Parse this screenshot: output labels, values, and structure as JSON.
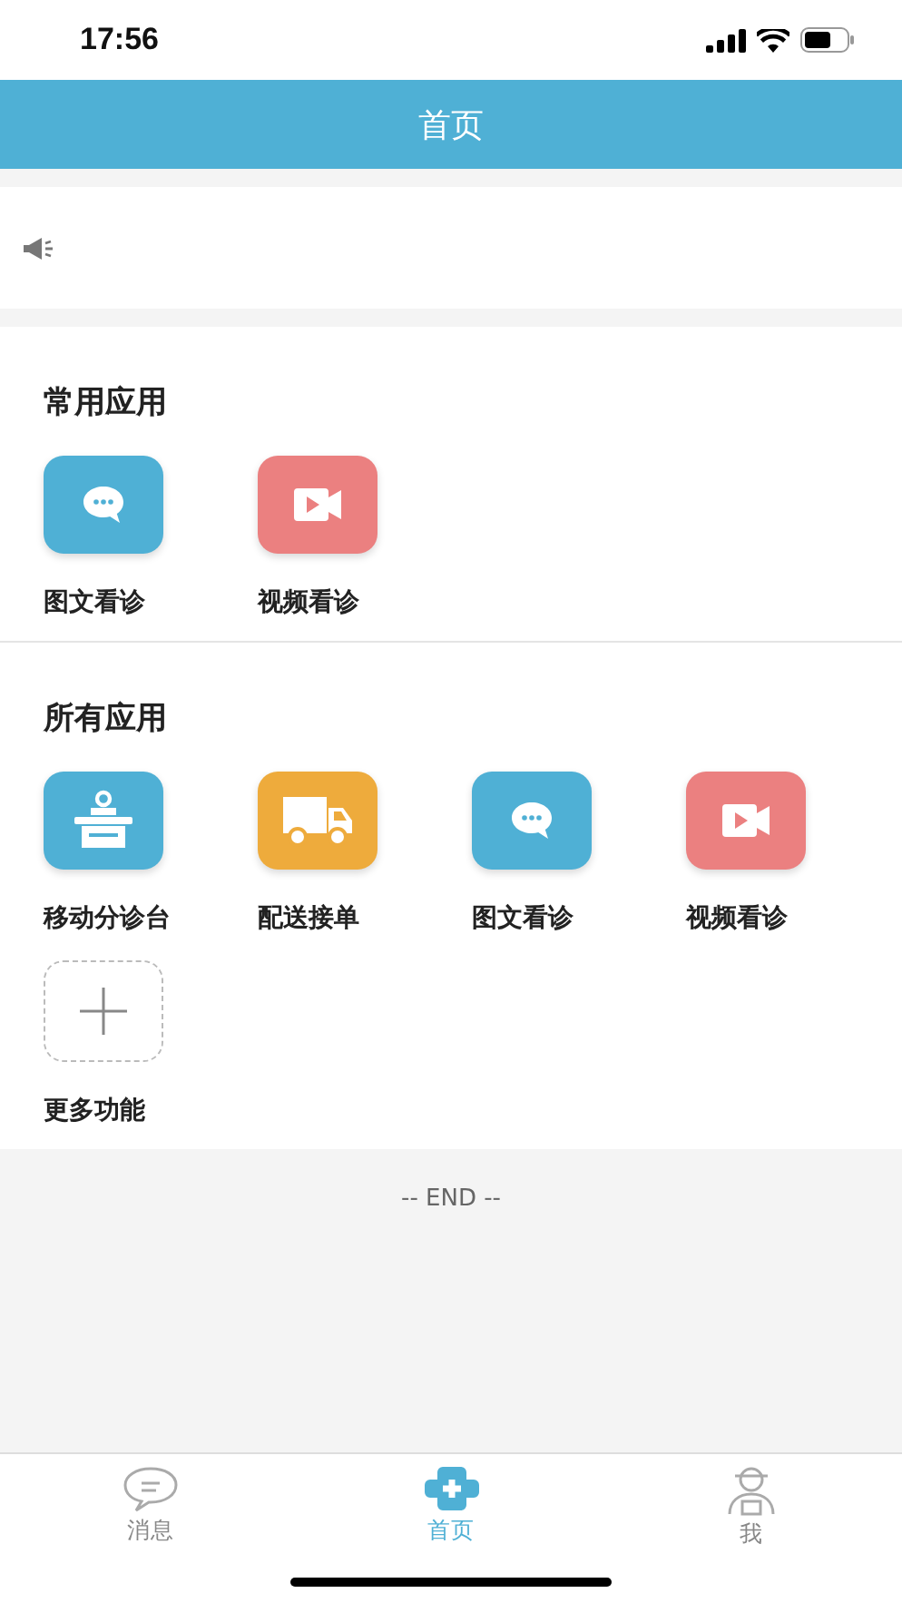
{
  "status_bar": {
    "time": "17:56"
  },
  "header": {
    "title": "首页"
  },
  "sections": [
    {
      "title": "常用应用",
      "apps": [
        {
          "label": "图文看诊",
          "kind": "chat",
          "color": "#4fb0d5"
        },
        {
          "label": "视频看诊",
          "kind": "video",
          "color": "#eb8080"
        }
      ]
    },
    {
      "title": "所有应用",
      "apps": [
        {
          "label": "移动分诊台",
          "kind": "desk",
          "color": "#4fb0d5"
        },
        {
          "label": "配送接单",
          "kind": "truck",
          "color": "#eeab3c"
        },
        {
          "label": "图文看诊",
          "kind": "chat",
          "color": "#4fb0d5"
        },
        {
          "label": "视频看诊",
          "kind": "video",
          "color": "#eb8080"
        },
        {
          "label": "更多功能",
          "kind": "add"
        }
      ]
    }
  ],
  "end_text": "-- END --",
  "tab_bar": [
    {
      "label": "消息",
      "kind": "chat",
      "selected": false
    },
    {
      "label": "首页",
      "kind": "cross",
      "selected": true
    },
    {
      "label": "我",
      "kind": "person",
      "selected": false
    }
  ]
}
